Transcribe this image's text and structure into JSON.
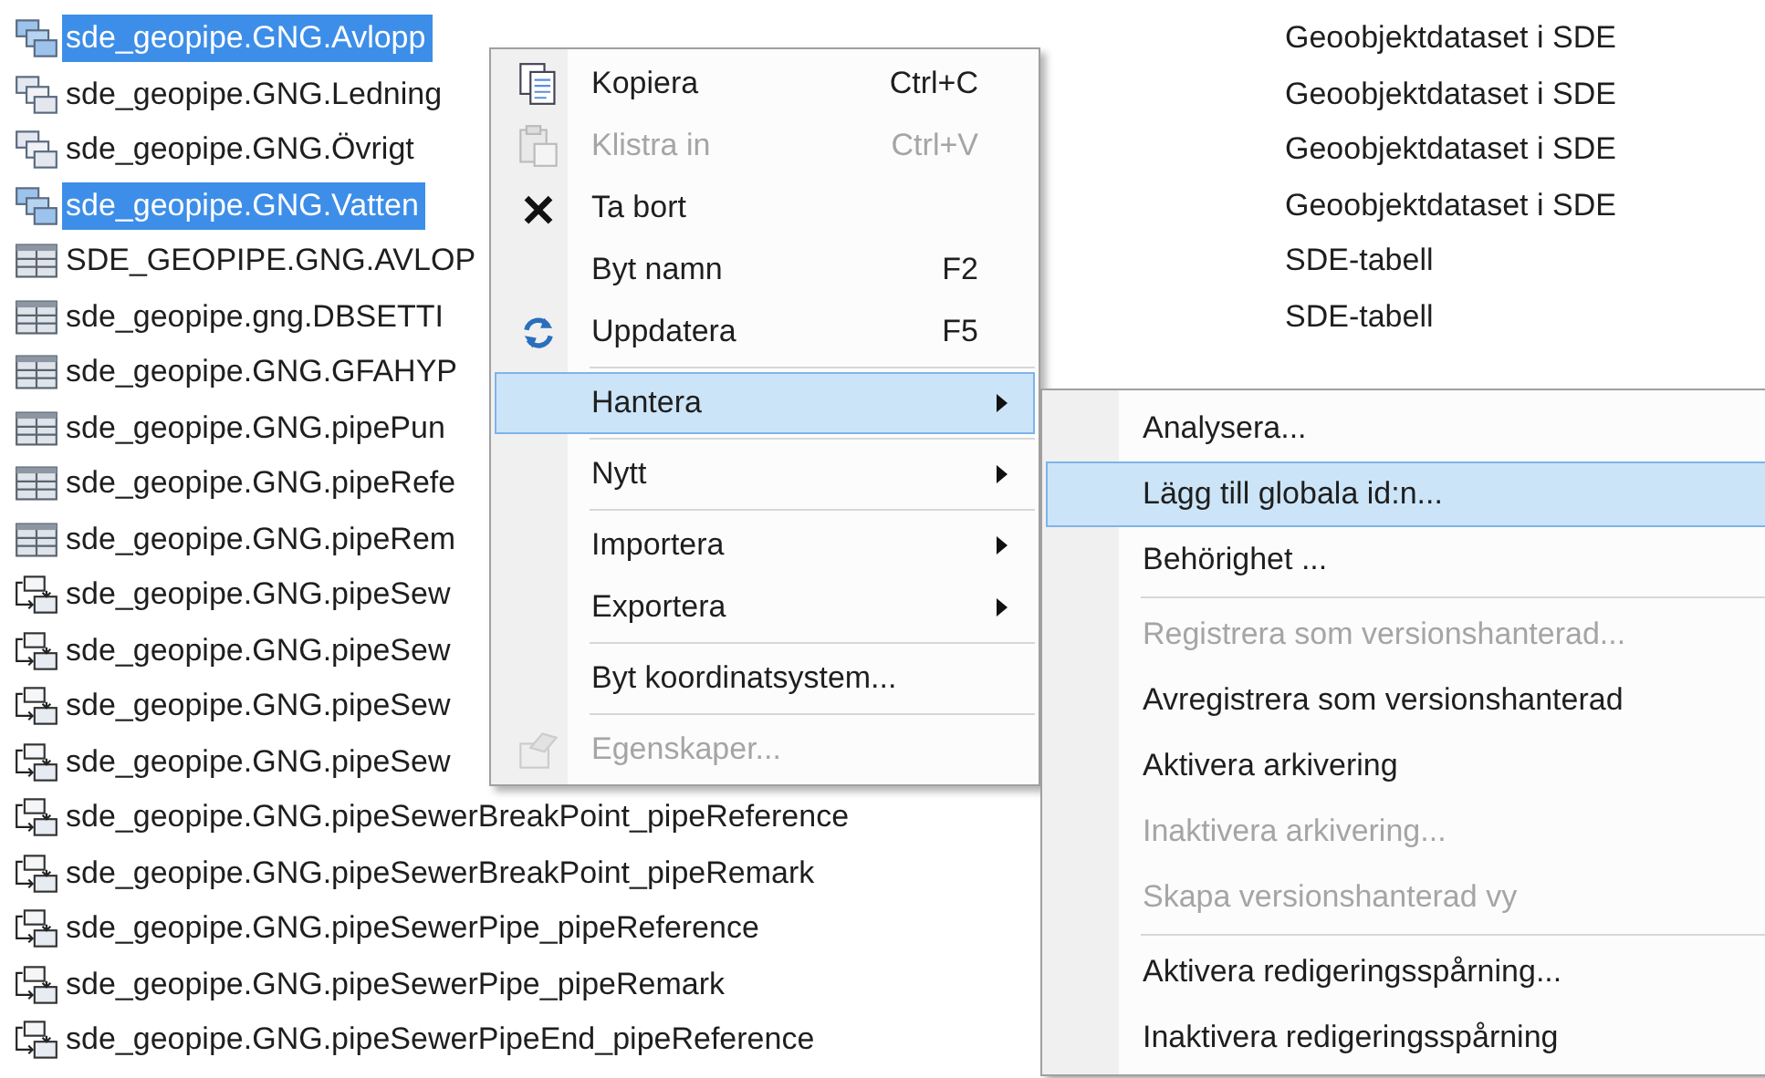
{
  "rows": [
    {
      "kind": "dataset",
      "name": "sde_geopipe.GNG.Avlopp",
      "type": "Geoobjektdataset i SDE",
      "selected": true
    },
    {
      "kind": "dataset",
      "name": "sde_geopipe.GNG.Ledning",
      "type": "Geoobjektdataset i SDE",
      "selected": false
    },
    {
      "kind": "dataset",
      "name": "sde_geopipe.GNG.Övrigt",
      "type": "Geoobjektdataset i SDE",
      "selected": false
    },
    {
      "kind": "dataset",
      "name": "sde_geopipe.GNG.Vatten",
      "type": "Geoobjektdataset i SDE",
      "selected": true
    },
    {
      "kind": "table",
      "name": "SDE_GEOPIPE.GNG.AVLOP",
      "type": "SDE-tabell",
      "selected": false
    },
    {
      "kind": "table",
      "name": "sde_geopipe.gng.DBSETTI",
      "type": "SDE-tabell",
      "selected": false
    },
    {
      "kind": "table",
      "name": "sde_geopipe.GNG.GFAHYP",
      "selected": false
    },
    {
      "kind": "table",
      "name": "sde_geopipe.GNG.pipePun",
      "selected": false
    },
    {
      "kind": "table",
      "name": "sde_geopipe.GNG.pipeRefe",
      "selected": false
    },
    {
      "kind": "table",
      "name": "sde_geopipe.GNG.pipeRem",
      "selected": false
    },
    {
      "kind": "relationship",
      "name": "sde_geopipe.GNG.pipeSew",
      "selected": false
    },
    {
      "kind": "relationship",
      "name": "sde_geopipe.GNG.pipeSew",
      "selected": false
    },
    {
      "kind": "relationship",
      "name": "sde_geopipe.GNG.pipeSew",
      "selected": false
    },
    {
      "kind": "relationship",
      "name": "sde_geopipe.GNG.pipeSew",
      "selected": false
    },
    {
      "kind": "relationship",
      "name": "sde_geopipe.GNG.pipeSewerBreakPoint_pipeReference",
      "selected": false
    },
    {
      "kind": "relationship",
      "name": "sde_geopipe.GNG.pipeSewerBreakPoint_pipeRemark",
      "selected": false
    },
    {
      "kind": "relationship",
      "name": "sde_geopipe.GNG.pipeSewerPipe_pipeReference",
      "selected": false
    },
    {
      "kind": "relationship",
      "name": "sde_geopipe.GNG.pipeSewerPipe_pipeRemark",
      "selected": false
    },
    {
      "kind": "relationship",
      "name": "sde_geopipe.GNG.pipeSewerPipeEnd_pipeReference",
      "selected": false
    }
  ],
  "context_menu": [
    {
      "kind": "item",
      "label": "Kopiera",
      "shortcut": "Ctrl+C",
      "disabled": false,
      "selected": false,
      "submenu": false
    },
    {
      "kind": "item",
      "label": "Klistra in",
      "shortcut": "Ctrl+V",
      "disabled": true,
      "selected": false,
      "submenu": false
    },
    {
      "kind": "item",
      "label": "Ta bort",
      "disabled": false,
      "selected": false,
      "submenu": false
    },
    {
      "kind": "item",
      "label": "Byt namn",
      "shortcut": "F2",
      "disabled": false,
      "selected": false,
      "submenu": false
    },
    {
      "kind": "item",
      "label": "Uppdatera",
      "shortcut": "F5",
      "disabled": false,
      "selected": false,
      "submenu": false
    },
    {
      "kind": "separator"
    },
    {
      "kind": "item",
      "label": "Hantera",
      "disabled": false,
      "selected": true,
      "submenu": true
    },
    {
      "kind": "separator"
    },
    {
      "kind": "item",
      "label": "Nytt",
      "disabled": false,
      "selected": false,
      "submenu": true
    },
    {
      "kind": "separator"
    },
    {
      "kind": "item",
      "label": "Importera",
      "disabled": false,
      "selected": false,
      "submenu": true
    },
    {
      "kind": "item",
      "label": "Exportera",
      "disabled": false,
      "selected": false,
      "submenu": true
    },
    {
      "kind": "separator"
    },
    {
      "kind": "item",
      "label": "Byt koordinatsystem...",
      "disabled": false,
      "selected": false,
      "submenu": false
    },
    {
      "kind": "separator"
    },
    {
      "kind": "item",
      "label": "Egenskaper...",
      "disabled": true,
      "selected": false,
      "submenu": false
    }
  ],
  "submenu": [
    {
      "kind": "item",
      "label": "Analysera...",
      "disabled": false,
      "selected": false
    },
    {
      "kind": "item",
      "label": "Lägg till globala id:n...",
      "disabled": false,
      "selected": true
    },
    {
      "kind": "item",
      "label": "Behörighet ...",
      "disabled": false,
      "selected": false
    },
    {
      "kind": "separator"
    },
    {
      "kind": "item",
      "label": "Registrera som versionshanterad...",
      "disabled": true,
      "selected": false
    },
    {
      "kind": "item",
      "label": "Avregistrera som versionshanterad",
      "disabled": false,
      "selected": false
    },
    {
      "kind": "item",
      "label": "Aktivera arkivering",
      "disabled": false,
      "selected": false
    },
    {
      "kind": "item",
      "label": "Inaktivera arkivering...",
      "disabled": true,
      "selected": false
    },
    {
      "kind": "item",
      "label": "Skapa versionshanterad vy",
      "disabled": true,
      "selected": false
    },
    {
      "kind": "separator"
    },
    {
      "kind": "item",
      "label": "Aktivera redigeringsspårning...",
      "disabled": false,
      "selected": false
    },
    {
      "kind": "item",
      "label": "Inaktivera redigeringsspårning",
      "disabled": false,
      "selected": false
    }
  ]
}
